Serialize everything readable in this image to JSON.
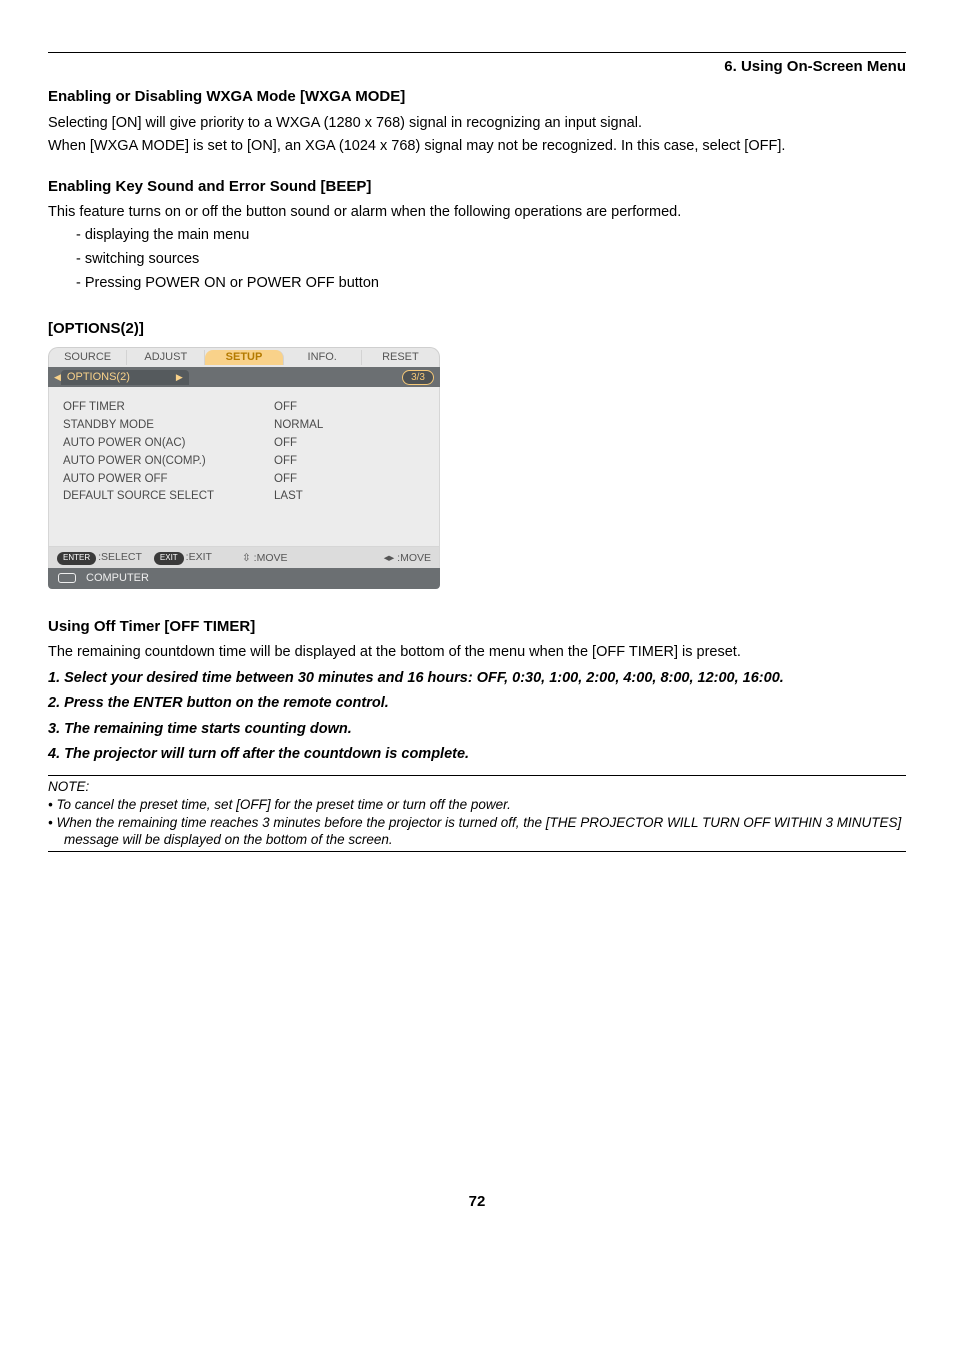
{
  "chapter": "6. Using On-Screen Menu",
  "s1": {
    "title": "Enabling or Disabling WXGA Mode [WXGA MODE]",
    "p1": "Selecting [ON] will give priority to a WXGA (1280 x 768) signal in recognizing an input signal.",
    "p2": "When [WXGA MODE] is set to [ON], an XGA (1024 x 768) signal may not be recognized. In this case, select [OFF]."
  },
  "s2": {
    "title": "Enabling Key Sound and Error Sound [BEEP]",
    "p1": "This feature turns on or off the button sound or alarm when the following operations are performed.",
    "b1": "- displaying the main menu",
    "b2": "- switching sources",
    "b3": "- Pressing POWER ON or POWER OFF button"
  },
  "s3": {
    "title": "[OPTIONS(2)]"
  },
  "osd": {
    "tabs": {
      "source": "SOURCE",
      "adjust": "ADJUST",
      "setup": "SETUP",
      "info": "INFO.",
      "reset": "RESET"
    },
    "subtab": "OPTIONS(2)",
    "pagepill": "3/3",
    "rows": [
      {
        "label": "OFF TIMER",
        "value": "OFF"
      },
      {
        "label": "STANDBY MODE",
        "value": "NORMAL"
      },
      {
        "label": "AUTO POWER ON(AC)",
        "value": "OFF"
      },
      {
        "label": "AUTO POWER ON(COMP.)",
        "value": "OFF"
      },
      {
        "label": "AUTO POWER OFF",
        "value": "OFF"
      },
      {
        "label": "DEFAULT SOURCE SELECT",
        "value": "LAST"
      }
    ],
    "nav": {
      "enterPill": "ENTER",
      "enterLabel": ":SELECT",
      "exitPill": "EXIT",
      "exitLabel": ":EXIT",
      "vicon": "⇳",
      "vlabel": ":MOVE",
      "hicon": "◂▸",
      "hlabel": ":MOVE"
    },
    "source": "COMPUTER"
  },
  "s4": {
    "title": "Using Off Timer [OFF TIMER]",
    "p1": "The remaining countdown time will be displayed at the bottom of the menu when the [OFF TIMER] is preset.",
    "o1": "1. Select your desired time between 30 minutes and 16 hours: OFF, 0:30, 1:00, 2:00, 4:00, 8:00, 12:00, 16:00.",
    "o2": "2. Press the ENTER button on the remote control.",
    "o3": "3. The remaining time starts counting down.",
    "o4": "4. The projector will turn off after the countdown is complete."
  },
  "note": {
    "label": "NOTE:",
    "n1": "•  To cancel the preset time, set [OFF] for the preset time or turn off the power.",
    "n2": "•  When the remaining time reaches 3 minutes before the projector is turned off, the [THE PROJECTOR WILL TURN OFF WITHIN 3 MINUTES] message will be displayed on the bottom of the screen."
  },
  "pagenum": "72"
}
